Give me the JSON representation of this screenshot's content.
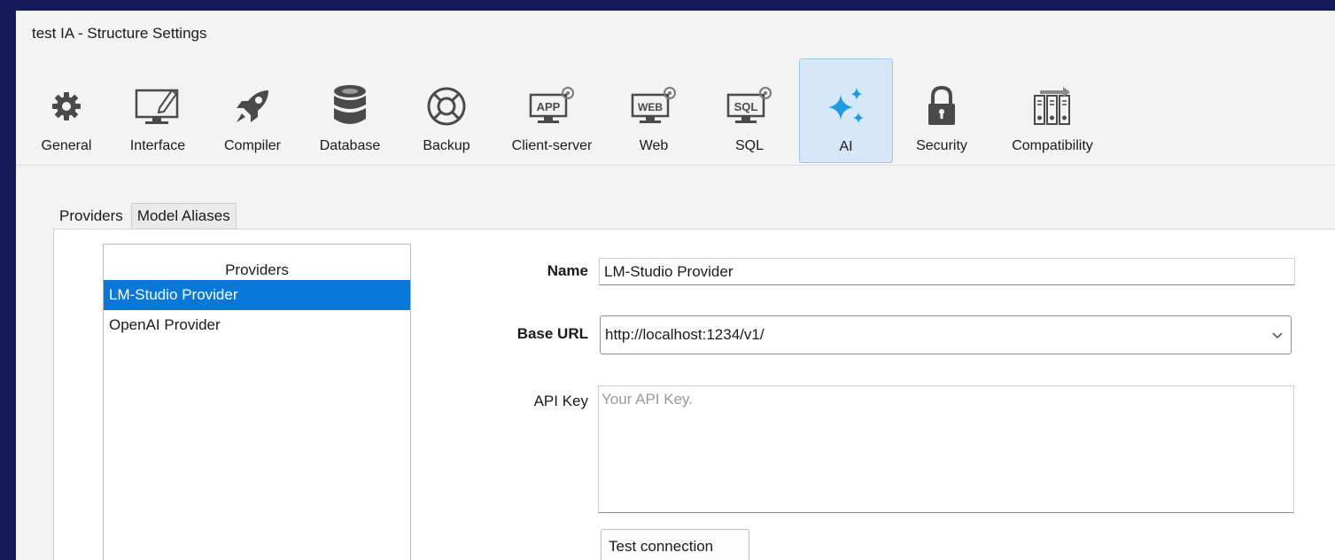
{
  "window": {
    "title": "test IA - Structure Settings"
  },
  "toolbar": {
    "items": [
      {
        "label": "General",
        "icon": "gear-icon"
      },
      {
        "label": "Interface",
        "icon": "monitor-pencil-icon"
      },
      {
        "label": "Compiler",
        "icon": "rocket-icon"
      },
      {
        "label": "Database",
        "icon": "database-icon"
      },
      {
        "label": "Backup",
        "icon": "lifebuoy-icon"
      },
      {
        "label": "Client-server",
        "icon": "app-monitor-icon",
        "badge": "APP"
      },
      {
        "label": "Web",
        "icon": "web-monitor-icon",
        "badge": "WEB"
      },
      {
        "label": "SQL",
        "icon": "sql-monitor-icon",
        "badge": "SQL"
      },
      {
        "label": "AI",
        "icon": "sparkles-icon",
        "selected": true
      },
      {
        "label": "Security",
        "icon": "padlock-icon"
      },
      {
        "label": "Compatibility",
        "icon": "compatibility-icon"
      }
    ]
  },
  "tabs": [
    {
      "label": "Providers",
      "active": true
    },
    {
      "label": "Model Aliases",
      "active": false
    }
  ],
  "providers": {
    "header": "Providers",
    "items": [
      {
        "label": "LM-Studio Provider",
        "selected": true
      },
      {
        "label": "OpenAI Provider",
        "selected": false
      }
    ]
  },
  "form": {
    "name_label": "Name",
    "name_value": "LM-Studio Provider",
    "base_url_label": "Base URL",
    "base_url_value": "http://localhost:1234/v1/",
    "api_key_label": "API Key",
    "api_key_placeholder": "Your API Key.",
    "test_button": "Test connection"
  },
  "colors": {
    "accent": "#0a78d7",
    "selected_tool_bg": "#d6e8f7",
    "ai_icon": "#1f9be0",
    "desktop_bg": "#141a5a"
  }
}
